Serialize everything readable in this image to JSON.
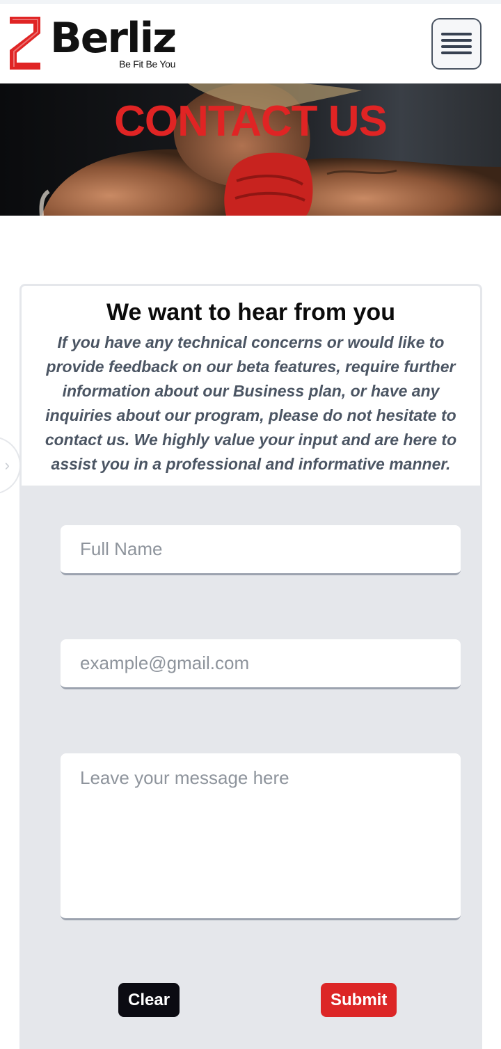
{
  "brand": {
    "name": "Berliz",
    "tagline": "Be Fit Be You",
    "color": "#e02424"
  },
  "header": {
    "menu_icon": "hamburger-menu-icon"
  },
  "hero": {
    "title": "CONTACT US",
    "image": "boxer-with-red-gloves"
  },
  "contact_card": {
    "title": "We want to hear from you",
    "description": "If you have any technical concerns or would like to provide feedback on our beta features, require further information about our Business plan, or have any inquiries about our program, please do not hesitate to contact us. We highly value your input and are here to assist you in a professional and informative manner."
  },
  "form": {
    "name_placeholder": "Full Name",
    "email_placeholder": "example@gmail.com",
    "message_placeholder": "Leave your message here",
    "clear_label": "Clear",
    "submit_label": "Submit"
  },
  "side_toggle": {
    "icon": "chevron-right-icon",
    "glyph": "›"
  },
  "colors": {
    "accent": "#dc2626",
    "form_bg": "#e5e7eb",
    "dark_button": "#0b0b12"
  }
}
